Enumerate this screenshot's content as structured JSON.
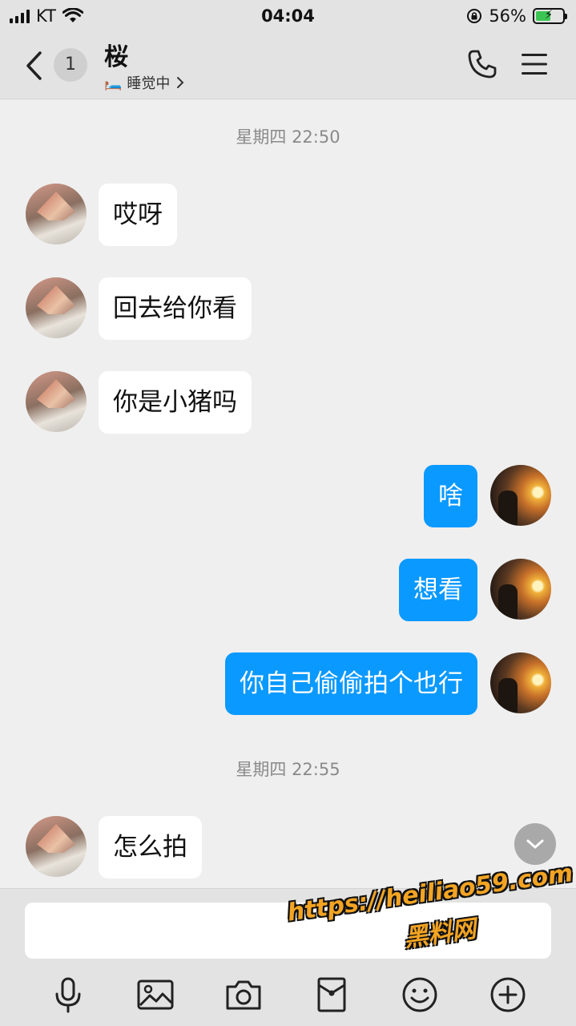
{
  "status_bar": {
    "carrier": "KT",
    "time": "04:04",
    "battery_percent": "56%",
    "battery_level": 0.56
  },
  "header": {
    "unread_count": "1",
    "contact_name": "桜",
    "contact_status": "睡觉中",
    "status_emoji": "🛏️"
  },
  "messages": [
    {
      "type": "time",
      "text": "星期四 22:50"
    },
    {
      "type": "in",
      "text": "哎呀"
    },
    {
      "type": "in",
      "text": "回去给你看"
    },
    {
      "type": "in",
      "text": "你是小猪吗"
    },
    {
      "type": "out",
      "text": "啥"
    },
    {
      "type": "out",
      "text": "想看"
    },
    {
      "type": "out",
      "text": "你自己偷偷拍个也行"
    },
    {
      "type": "time",
      "text": "星期四 22:55"
    },
    {
      "type": "in",
      "text": "怎么拍"
    }
  ],
  "input": {
    "placeholder": ""
  },
  "toolbar": [
    "microphone-icon",
    "image-icon",
    "camera-icon",
    "red-packet-icon",
    "emoji-icon",
    "plus-icon"
  ],
  "watermark": {
    "url": "https://heiliao59.com",
    "name": "黑料网"
  },
  "colors": {
    "outgoing_bubble": "#0a99ff",
    "incoming_bubble": "#ffffff",
    "background": "#efefef",
    "bar": "#e3e3e3",
    "watermark": "#f3a423"
  }
}
